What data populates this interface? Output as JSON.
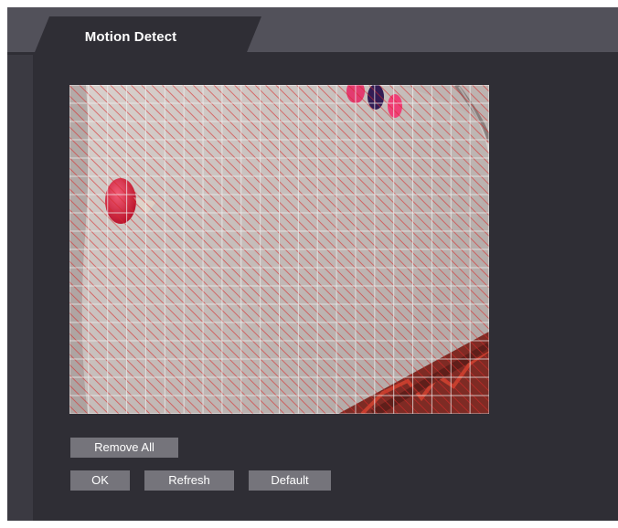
{
  "tab": {
    "title": "Motion Detect"
  },
  "buttons": {
    "remove_all": "Remove All",
    "ok": "OK",
    "refresh": "Refresh",
    "default": "Default"
  },
  "detection_grid": {
    "columns": 22,
    "rows": 18,
    "all_cells_selected": true,
    "region_stripe_color": "#d9292a",
    "grid_line_color": "#f0f0f0"
  },
  "colors": {
    "window_bg": "#3b3a42",
    "panel_bg": "#2f2e35",
    "tab_strip_bg": "#52515a",
    "button_bg": "#75747b",
    "text": "#ffffff"
  }
}
